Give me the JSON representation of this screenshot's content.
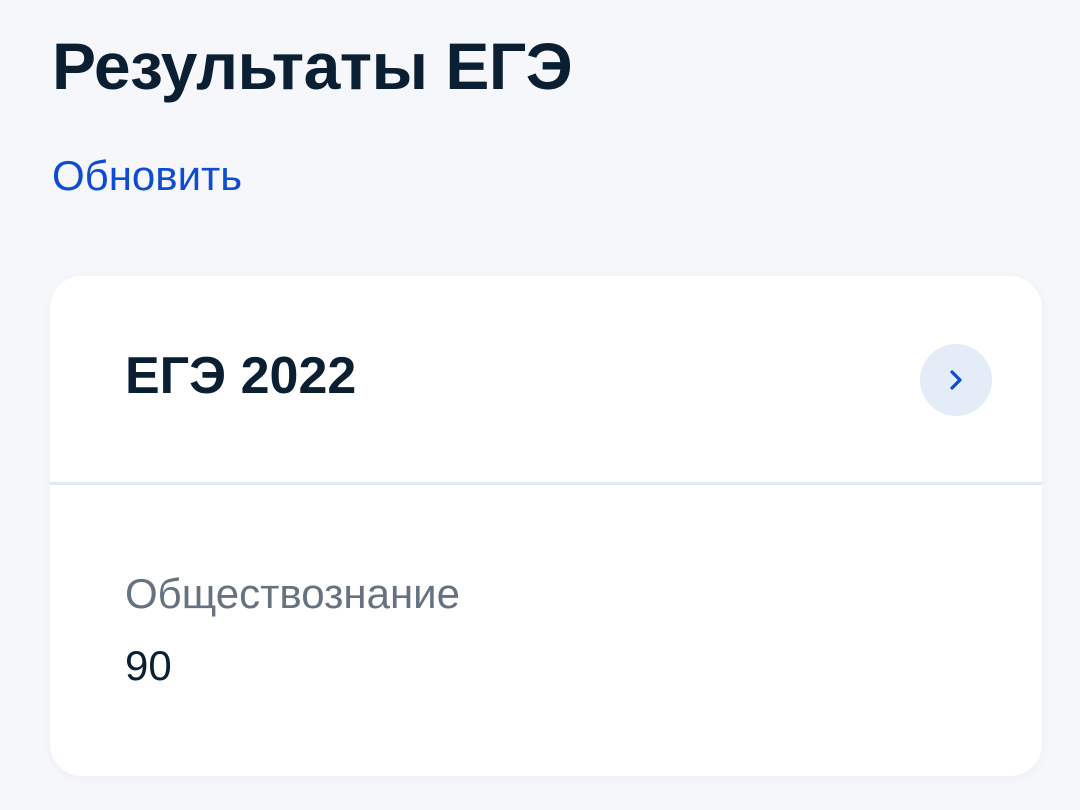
{
  "header": {
    "title": "Результаты ЕГЭ",
    "refresh_label": "Обновить"
  },
  "card": {
    "exam_title": "ЕГЭ 2022",
    "chevron_icon": "chevron-right-icon",
    "results": [
      {
        "subject": "Обществознание",
        "score": "90"
      }
    ]
  },
  "colors": {
    "background": "#f5f7fb",
    "title_text": "#0b1f33",
    "link": "#0d4cd3",
    "secondary_text": "#66727f",
    "chevron_bg": "#e4ecf7",
    "chevron": "#0d4cd3"
  }
}
